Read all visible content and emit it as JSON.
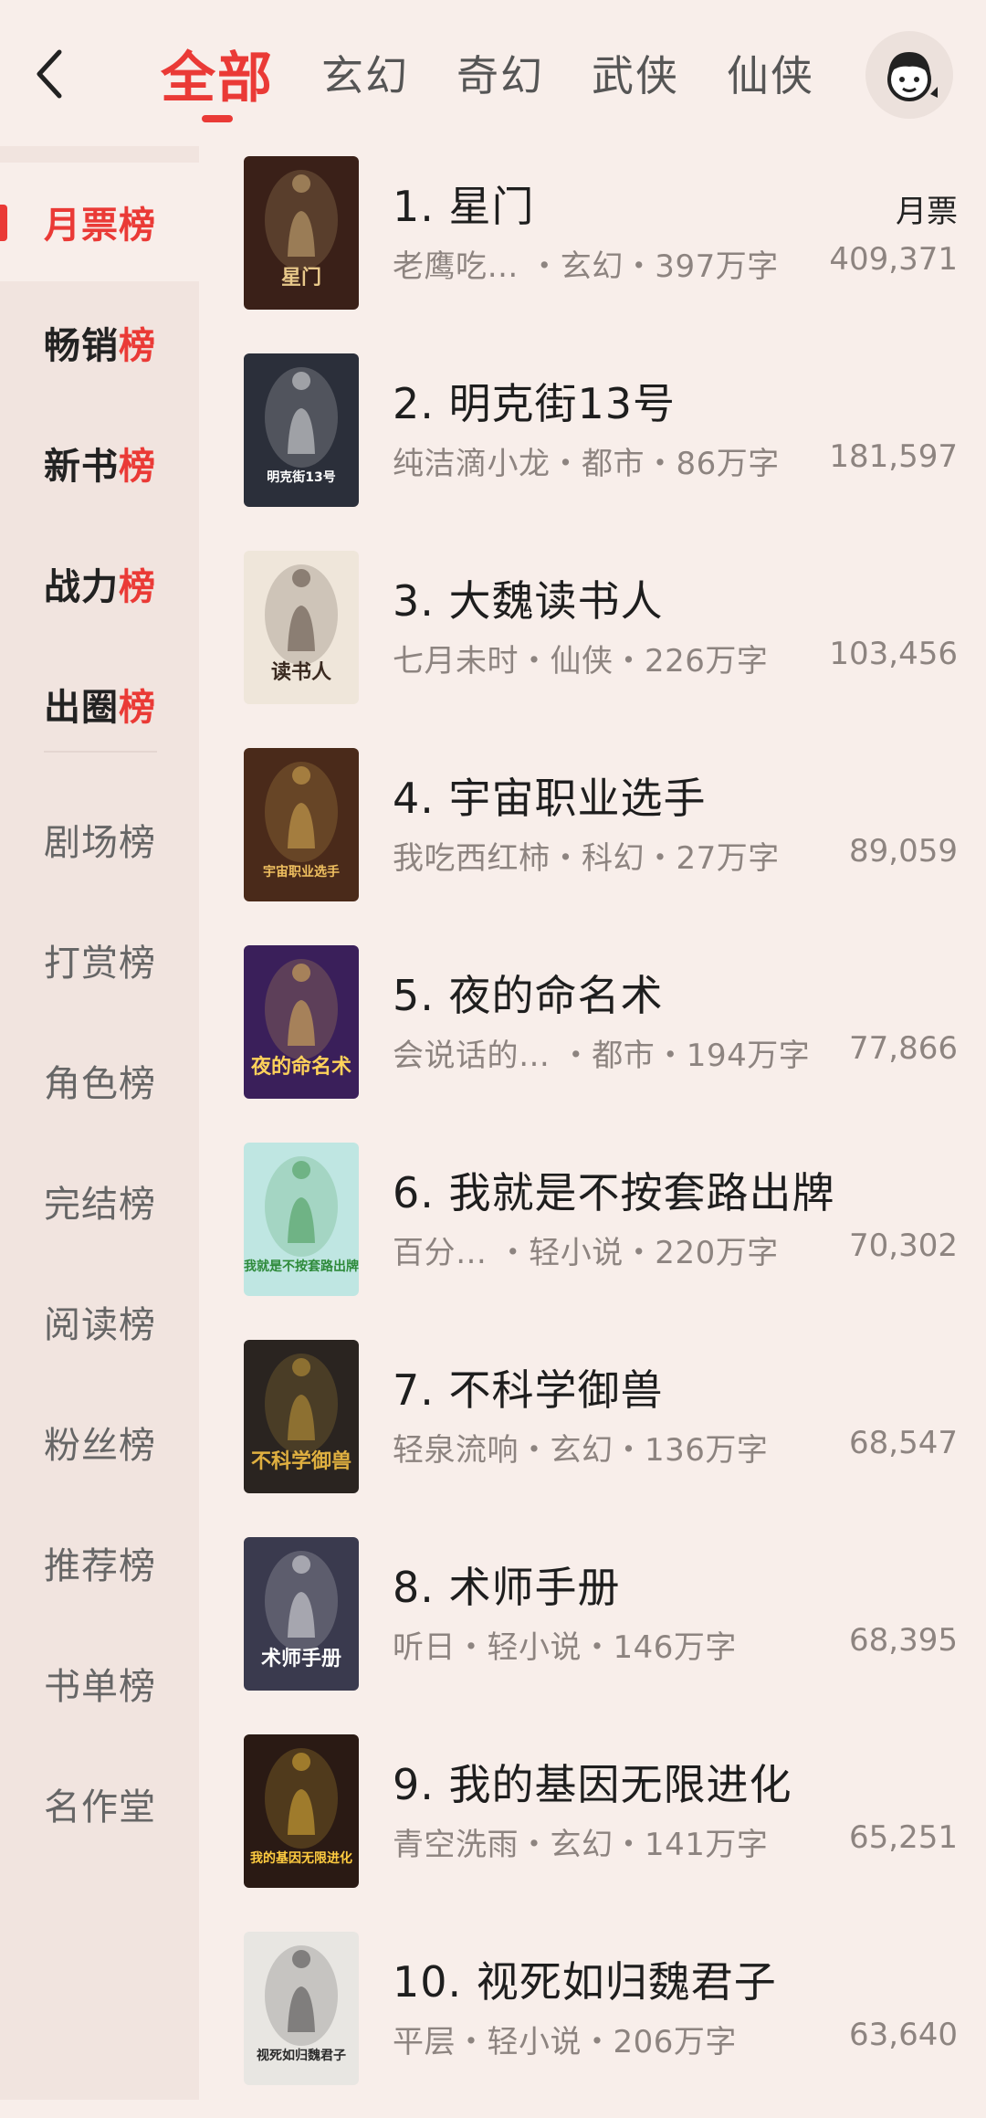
{
  "header": {
    "tabs": [
      {
        "label": "全部",
        "active": true
      },
      {
        "label": "玄幻"
      },
      {
        "label": "奇幻"
      },
      {
        "label": "武侠"
      },
      {
        "label": "仙侠"
      }
    ],
    "back_icon": "chevron-left-icon",
    "avatar_icon": "user-avatar-icon"
  },
  "sidebar": {
    "items": [
      {
        "head": "月票",
        "tail": "榜"
      },
      {
        "head": "畅销",
        "tail": "榜"
      },
      {
        "head": "新书",
        "tail": "榜"
      },
      {
        "head": "战力",
        "tail": "榜"
      },
      {
        "head": "出圈",
        "tail": "榜"
      },
      {
        "label": "剧场榜"
      },
      {
        "label": "打赏榜"
      },
      {
        "label": "角色榜"
      },
      {
        "label": "完结榜"
      },
      {
        "label": "阅读榜"
      },
      {
        "label": "粉丝榜"
      },
      {
        "label": "推荐榜"
      },
      {
        "label": "书单榜"
      },
      {
        "label": "名作堂"
      }
    ]
  },
  "list": {
    "value_label": "月票",
    "books": [
      {
        "title": "1. 星门",
        "meta": "老鹰吃… ・玄幻・397万字",
        "value": "409,371"
      },
      {
        "title": "2. 明克街13号",
        "meta": "纯洁滴小龙・都市・86万字",
        "value": "181,597"
      },
      {
        "title": "3. 大魏读书人",
        "meta": "七月未时・仙侠・226万字",
        "value": "103,456"
      },
      {
        "title": "4. 宇宙职业选手",
        "meta": "我吃西红柿・科幻・27万字",
        "value": "89,059"
      },
      {
        "title": "5. 夜的命名术",
        "meta": "会说话的… ・都市・194万字",
        "value": "77,866"
      },
      {
        "title": "6. 我就是不按套路出牌",
        "meta": "百分…   ・轻小说・220万字",
        "value": "70,302"
      },
      {
        "title": "7. 不科学御兽",
        "meta": "轻泉流响・玄幻・136万字",
        "value": "68,547"
      },
      {
        "title": "8. 术师手册",
        "meta": "听日・轻小说・146万字",
        "value": "68,395"
      },
      {
        "title": "9. 我的基因无限进化",
        "meta": "青空洗雨・玄幻・141万字",
        "value": "65,251"
      },
      {
        "title": "10. 视死如归魏君子",
        "meta": "平层・轻小说・206万字",
        "value": "63,640"
      }
    ]
  },
  "covers": [
    {
      "text": "星门",
      "bg": "#3a2018",
      "accent": "#e8c88a"
    },
    {
      "text": "明克街13号",
      "bg": "#2b2f3a",
      "accent": "#ffffff"
    },
    {
      "text": "读书人",
      "bg": "#efe6da",
      "accent": "#3a2a20"
    },
    {
      "text": "宇宙职业选手",
      "bg": "#4a2a1a",
      "accent": "#f0c060"
    },
    {
      "text": "夜的命名术",
      "bg": "#3a1f5a",
      "accent": "#ffd25a"
    },
    {
      "text": "我就是不按套路出牌",
      "bg": "#bfe6e2",
      "accent": "#2e8a3a"
    },
    {
      "text": "不科学御兽",
      "bg": "#2a2420",
      "accent": "#e0b040"
    },
    {
      "text": "术师手册",
      "bg": "#3a3a4e",
      "accent": "#ffffff"
    },
    {
      "text": "我的基因无限进化",
      "bg": "#2a1a14",
      "accent": "#ffcc40"
    },
    {
      "text": "视死如归魏君子",
      "bg": "#e8e6e2",
      "accent": "#2a2a2a"
    }
  ]
}
